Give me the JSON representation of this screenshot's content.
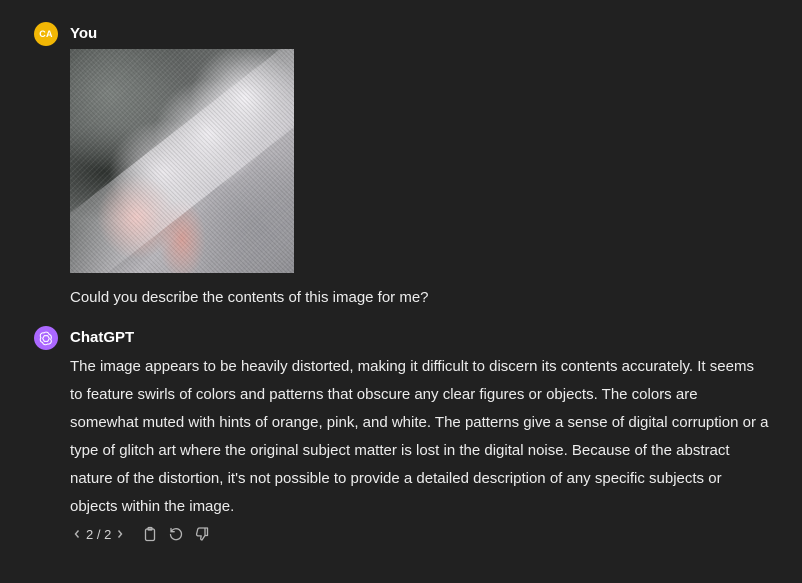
{
  "user_message": {
    "avatar_initials": "CA",
    "author": "You",
    "attachment_icon": "image",
    "text": "Could you describe the contents of this image for me?"
  },
  "assistant_message": {
    "author": "ChatGPT",
    "avatar_icon": "openai-logo-icon",
    "text": "The image appears to be heavily distorted, making it difficult to discern its contents accurately. It seems to feature swirls of colors and patterns that obscure any clear figures or objects. The colors are somewhat muted with hints of orange, pink, and white. The patterns give a sense of digital corruption or a type of glitch art where the original subject matter is lost in the digital noise. Because of the abstract nature of the distortion, it's not possible to provide a detailed description of any specific subjects or objects within the image.",
    "pager": "2 / 2",
    "actions": [
      "copy-icon",
      "regenerate-icon",
      "thumbs-down-icon"
    ]
  },
  "colors": {
    "background": "#212121",
    "user_avatar": "#f2b705",
    "assistant_avatar": "#ab68ff",
    "text": "#ececec"
  }
}
